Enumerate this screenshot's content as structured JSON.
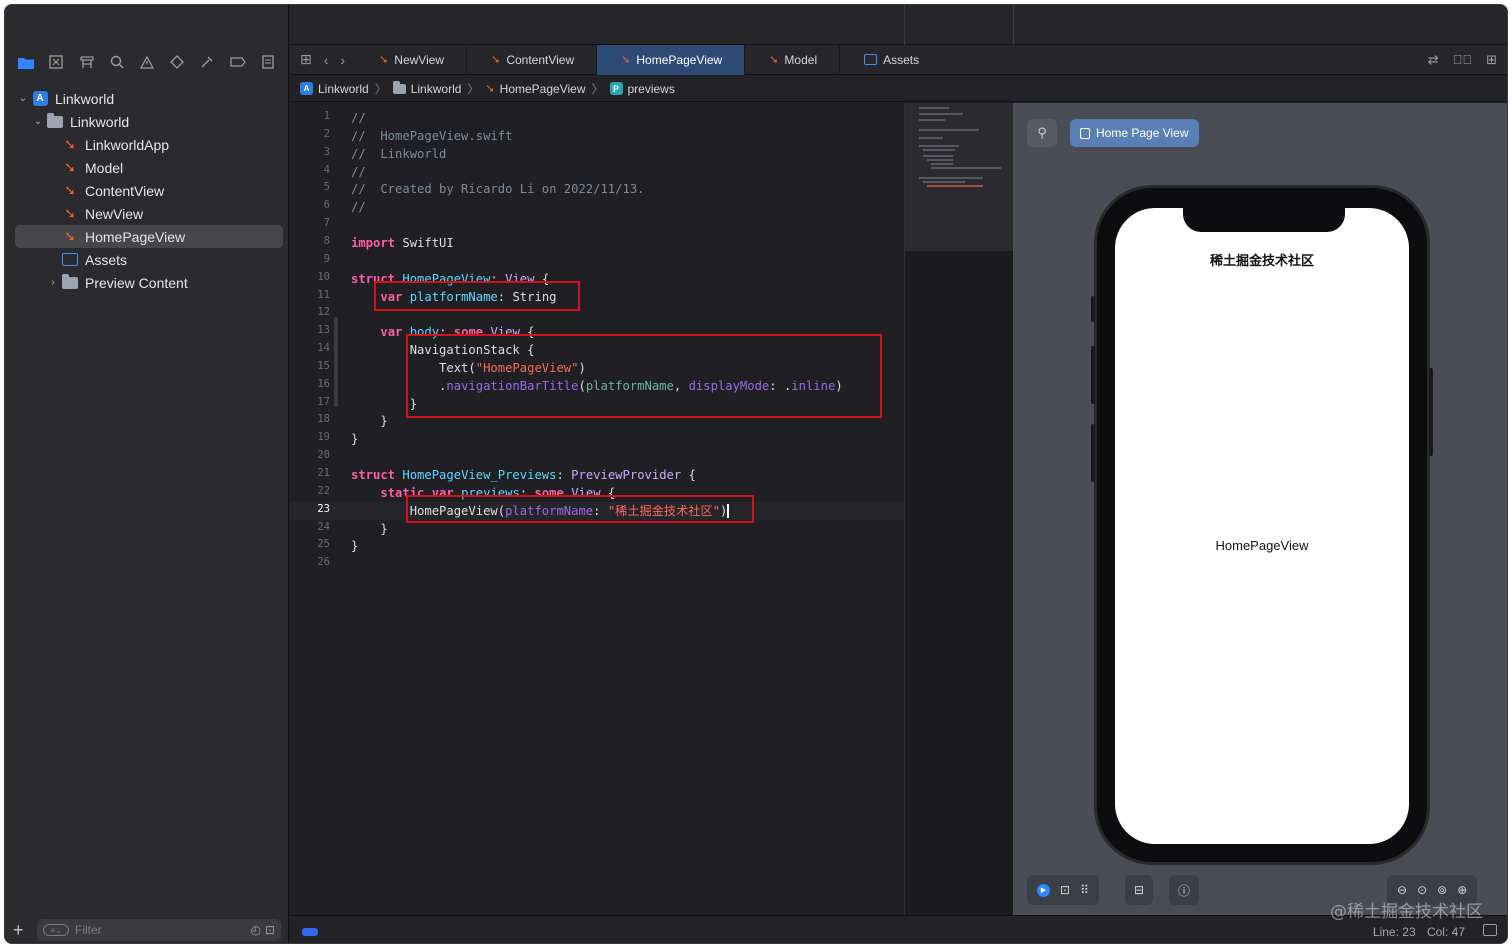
{
  "navigator": {
    "icons": [
      "folder-icon",
      "source-control-icon",
      "symbol-icon",
      "search-icon",
      "warning-icon",
      "test-icon",
      "debug-icon",
      "breakpoint-icon",
      "report-icon"
    ],
    "tree": [
      {
        "label": "Linkworld",
        "kind": "project",
        "level": 0,
        "expanded": true
      },
      {
        "label": "Linkworld",
        "kind": "folder",
        "level": 1,
        "expanded": true
      },
      {
        "label": "LinkworldApp",
        "kind": "swift",
        "level": 2
      },
      {
        "label": "Model",
        "kind": "swift",
        "level": 2
      },
      {
        "label": "ContentView",
        "kind": "swift",
        "level": 2
      },
      {
        "label": "NewView",
        "kind": "swift",
        "level": 2
      },
      {
        "label": "HomePageView",
        "kind": "swift",
        "level": 2,
        "selected": true
      },
      {
        "label": "Assets",
        "kind": "assets",
        "level": 2
      },
      {
        "label": "Preview Content",
        "kind": "folder",
        "level": 2,
        "expanded": false
      }
    ],
    "filter_placeholder": "Filter"
  },
  "tabs": [
    {
      "label": "NewView",
      "icon": "swift-icon",
      "active": false
    },
    {
      "label": "ContentView",
      "icon": "swift-icon",
      "active": false
    },
    {
      "label": "HomePageView",
      "icon": "swift-icon",
      "active": true
    },
    {
      "label": "Model",
      "icon": "swift-icon",
      "active": false
    },
    {
      "label": "Assets",
      "icon": "assets-icon",
      "active": false
    }
  ],
  "breadcrumb": [
    "Linkworld",
    "Linkworld",
    "HomePageView",
    "previews"
  ],
  "editor": {
    "current_line": 23,
    "line_numbers": [
      "1",
      "2",
      "3",
      "4",
      "5",
      "6",
      "7",
      "8",
      "9",
      "10",
      "11",
      "12",
      "13",
      "14",
      "15",
      "16",
      "17",
      "18",
      "19",
      "20",
      "21",
      "22",
      "23",
      "24",
      "25",
      "26"
    ],
    "lines": [
      [
        {
          "t": "//",
          "c": "cm"
        }
      ],
      [
        {
          "t": "//  HomePageView.swift",
          "c": "cm"
        }
      ],
      [
        {
          "t": "//  Linkworld",
          "c": "cm"
        }
      ],
      [
        {
          "t": "//",
          "c": "cm"
        }
      ],
      [
        {
          "t": "//  Created by Ricardo Li on 2022/11/13.",
          "c": "cm"
        }
      ],
      [
        {
          "t": "//",
          "c": "cm"
        }
      ],
      [],
      [
        {
          "t": "import",
          "c": "kw"
        },
        {
          "t": " SwiftUI",
          "c": "pl"
        }
      ],
      [],
      [
        {
          "t": "struct",
          "c": "kw"
        },
        {
          "t": " ",
          "c": "pl"
        },
        {
          "t": "HomePageView",
          "c": "ty"
        },
        {
          "t": ": ",
          "c": "pl"
        },
        {
          "t": "View",
          "c": "tyd"
        },
        {
          "t": " {",
          "c": "pl"
        }
      ],
      [
        {
          "t": "    ",
          "c": "pl"
        },
        {
          "t": "var",
          "c": "kw"
        },
        {
          "t": " ",
          "c": "pl"
        },
        {
          "t": "platformName",
          "c": "ty"
        },
        {
          "t": ": ",
          "c": "pl"
        },
        {
          "t": "String",
          "c": "pl"
        }
      ],
      [],
      [
        {
          "t": "    ",
          "c": "pl"
        },
        {
          "t": "var",
          "c": "kw"
        },
        {
          "t": " ",
          "c": "pl"
        },
        {
          "t": "body",
          "c": "ty"
        },
        {
          "t": ": ",
          "c": "pl"
        },
        {
          "t": "some",
          "c": "kw"
        },
        {
          "t": " ",
          "c": "pl"
        },
        {
          "t": "View",
          "c": "tyd"
        },
        {
          "t": " {",
          "c": "pl"
        }
      ],
      [
        {
          "t": "        NavigationStack {",
          "c": "pl"
        }
      ],
      [
        {
          "t": "            Text(",
          "c": "pl"
        },
        {
          "t": "\"HomePageView\"",
          "c": "str"
        },
        {
          "t": ")",
          "c": "pl"
        }
      ],
      [
        {
          "t": "            .",
          "c": "pl"
        },
        {
          "t": "navigationBarTitle",
          "c": "pr"
        },
        {
          "t": "(",
          "c": "pl"
        },
        {
          "t": "platformName",
          "c": "fn"
        },
        {
          "t": ", ",
          "c": "pl"
        },
        {
          "t": "displayMode",
          "c": "pr"
        },
        {
          "t": ": .",
          "c": "pl"
        },
        {
          "t": "inline",
          "c": "pr"
        },
        {
          "t": ")",
          "c": "pl"
        }
      ],
      [
        {
          "t": "        }",
          "c": "pl"
        }
      ],
      [
        {
          "t": "    }",
          "c": "pl"
        }
      ],
      [
        {
          "t": "}",
          "c": "pl"
        }
      ],
      [],
      [
        {
          "t": "struct",
          "c": "kw"
        },
        {
          "t": " ",
          "c": "pl"
        },
        {
          "t": "HomePageView_Previews",
          "c": "ty"
        },
        {
          "t": ": ",
          "c": "pl"
        },
        {
          "t": "PreviewProvider",
          "c": "tyd"
        },
        {
          "t": " {",
          "c": "pl"
        }
      ],
      [
        {
          "t": "    ",
          "c": "pl"
        },
        {
          "t": "static",
          "c": "kw"
        },
        {
          "t": " ",
          "c": "pl"
        },
        {
          "t": "var",
          "c": "kw"
        },
        {
          "t": " ",
          "c": "pl"
        },
        {
          "t": "previews",
          "c": "ty"
        },
        {
          "t": ": ",
          "c": "pl"
        },
        {
          "t": "some",
          "c": "kw"
        },
        {
          "t": " ",
          "c": "pl"
        },
        {
          "t": "View",
          "c": "tyd"
        },
        {
          "t": " {",
          "c": "pl"
        }
      ],
      [
        {
          "t": "        HomePageView(",
          "c": "pl"
        },
        {
          "t": "platformName",
          "c": "pr"
        },
        {
          "t": ": ",
          "c": "pl"
        },
        {
          "t": "\"稀土掘金技术社区\"",
          "c": "str"
        },
        {
          "t": ")",
          "c": "pl"
        }
      ],
      [
        {
          "t": "    }",
          "c": "pl"
        }
      ],
      [
        {
          "t": "}",
          "c": "pl"
        }
      ],
      []
    ]
  },
  "canvas": {
    "preview_label": "Home Page View",
    "nav_title": "稀土掘金技术社区",
    "body_text": "HomePageView"
  },
  "status": {
    "line": "Line: 23",
    "col": "Col: 47"
  },
  "watermark": "@稀土掘金技术社区"
}
